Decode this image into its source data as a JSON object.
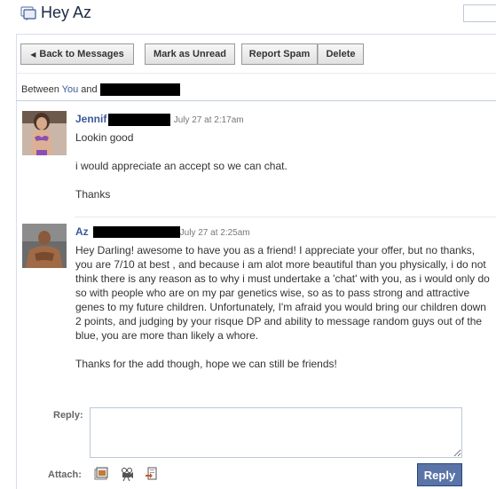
{
  "header": {
    "title": "Hey Az"
  },
  "toolbar": {
    "back_label": "Back to Messages",
    "unread_label": "Mark as Unread",
    "spam_label": "Report Spam",
    "delete_label": "Delete"
  },
  "thread": {
    "between_prefix": "Between ",
    "between_you": "You",
    "between_and": " and"
  },
  "messages": [
    {
      "author": "Jennif",
      "time": "July 27 at 2:17am",
      "paragraphs": [
        "Lookin good",
        "i would appreciate an accept so we can chat.",
        "Thanks"
      ]
    },
    {
      "author": "Az",
      "time": "July 27 at 2:25am",
      "paragraphs": [
        "Hey Darling! awesome to have you as a friend! I appreciate your offer, but no thanks, you are 7/10 at best , and because i am alot more beautiful than you physically, i do not think there is any reason as to why i must undertake a 'chat' with you, as i would only do so with people who are on my par genetics wise, so as to pass strong and attractive genes to my future children. Unfortunately, I'm afraid you would bring our children down 2 points, and judging by your risque DP and ability to message random guys out of the blue, you are more than likely a whore.",
        "Thanks for the add though, hope we can still be friends!"
      ]
    }
  ],
  "reply": {
    "label": "Reply:",
    "value": "",
    "attach_label": "Attach:",
    "button_label": "Reply"
  },
  "icons": [
    "messages-icon",
    "photo-icon",
    "video-icon",
    "link-icon"
  ],
  "colors": {
    "link": "#3b5998",
    "reply_button": "#5b74a8",
    "border": "#bdc7d8"
  }
}
